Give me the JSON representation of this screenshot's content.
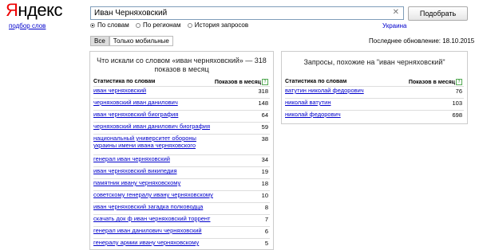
{
  "header": {
    "logo_first": "Я",
    "logo_rest": "ндекс",
    "sublink": "подбор слов",
    "search_value": "Иван Черняховский",
    "clear_glyph": "✕",
    "search_button": "Подобрать",
    "radios": [
      {
        "label": "По словам",
        "selected": true
      },
      {
        "label": "По регионам",
        "selected": false
      },
      {
        "label": "История запросов",
        "selected": false
      }
    ],
    "region": "Украина"
  },
  "tabs": [
    {
      "label": "Все",
      "active": true
    },
    {
      "label": "Только мобильные",
      "active": false
    }
  ],
  "updated": "Последнее обновление: 18.10.2015",
  "left": {
    "title": "Что искали со словом «иван черняховский» — 318 показов в месяц",
    "col1": "Статистика по словам",
    "col2": "Показов в месяц",
    "rows": [
      {
        "q": "иван черняховский",
        "n": "318"
      },
      {
        "q": "черняховский иван данилович",
        "n": "148"
      },
      {
        "q": "иван черняховский биография",
        "n": "64"
      },
      {
        "q": "черняховский иван данилович биография",
        "n": "59"
      },
      {
        "q": "национальный университет обороны украины имени ивана черняховского",
        "n": "38"
      },
      {
        "q": "генерал иван черняховский",
        "n": "34"
      },
      {
        "q": "иван черняховский википедия",
        "n": "19"
      },
      {
        "q": "памятник ивану черняховскому",
        "n": "18"
      },
      {
        "q": "советскому генералу ивану черняховскому",
        "n": "10"
      },
      {
        "q": "иван черняховский загадка полководца",
        "n": "8"
      },
      {
        "q": "скачать док ф иван черняховский торрент",
        "n": "7"
      },
      {
        "q": "генерал иван данилович черняховский",
        "n": "6"
      },
      {
        "q": "генералу армии ивану черняховскому",
        "n": "5"
      }
    ]
  },
  "right": {
    "title": "Запросы, похожие на \"иван черняховский\"",
    "col1": "Статистика по словам",
    "col2": "Показов в месяц",
    "rows": [
      {
        "q": "ватутин николай федорович",
        "n": "76"
      },
      {
        "q": "николай ватутин",
        "n": "103"
      },
      {
        "q": "николай федорович",
        "n": "698"
      }
    ]
  },
  "icons": {
    "help": "?"
  }
}
